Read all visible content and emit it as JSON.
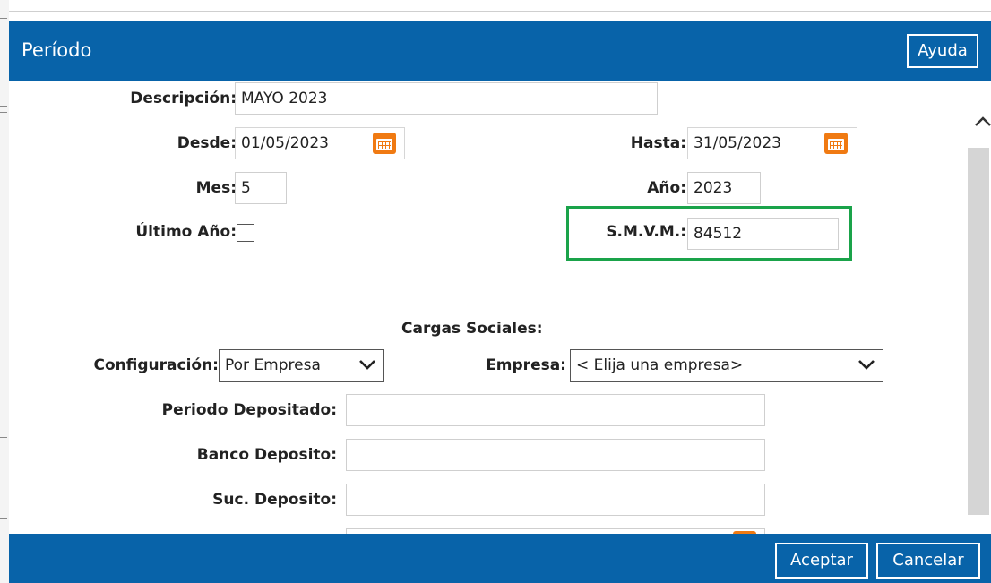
{
  "dialog": {
    "title": "Período",
    "help_label": "Ayuda"
  },
  "form": {
    "descripcion": {
      "label": "Descripción:",
      "value": "MAYO 2023"
    },
    "desde": {
      "label": "Desde:",
      "value": "01/05/2023"
    },
    "hasta": {
      "label": "Hasta:",
      "value": "31/05/2023"
    },
    "mes": {
      "label": "Mes:",
      "value": "5"
    },
    "anio": {
      "label": "Año:",
      "value": "2023"
    },
    "ultimo_anio": {
      "label": "Último Año:",
      "checked": false
    },
    "smvm": {
      "label": "S.M.V.M.:",
      "value": "84512"
    }
  },
  "cargas_sociales": {
    "title": "Cargas Sociales:",
    "configuracion": {
      "label": "Configuración:",
      "selected": "Por Empresa"
    },
    "empresa": {
      "label": "Empresa:",
      "selected": "< Elija una empresa>"
    },
    "periodo_depositado": {
      "label": "Periodo Depositado:",
      "value": ""
    },
    "banco_deposito": {
      "label": "Banco Deposito:",
      "value": ""
    },
    "suc_deposito": {
      "label": "Suc. Deposito:",
      "value": ""
    }
  },
  "footer": {
    "accept_label": "Aceptar",
    "cancel_label": "Cancelar"
  },
  "colors": {
    "primary": "#0863a9",
    "highlight": "#1aa34a",
    "calendar": "#f07a12"
  }
}
